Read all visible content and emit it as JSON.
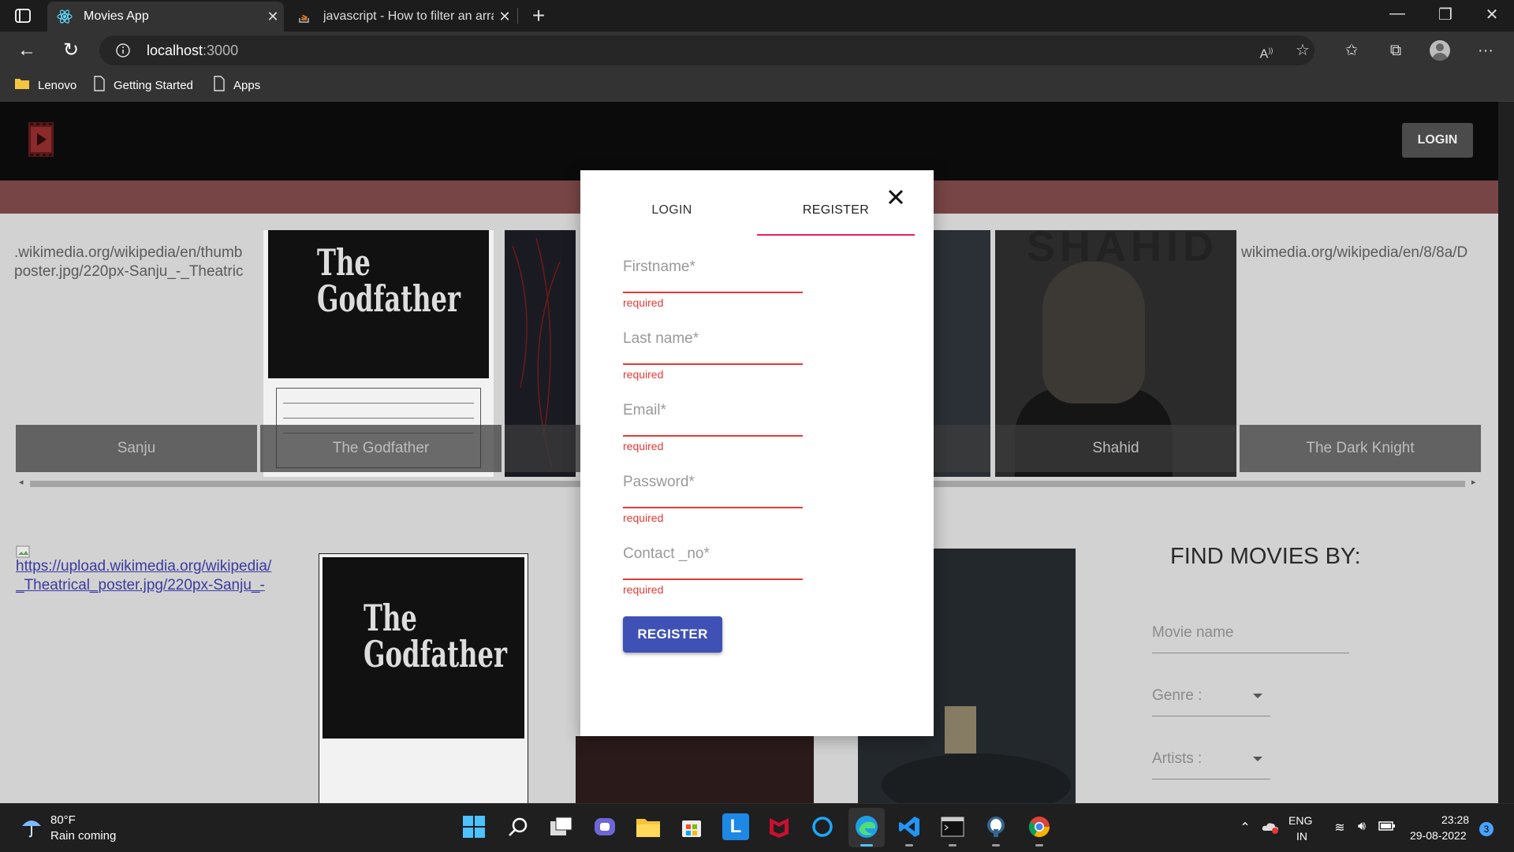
{
  "browser": {
    "tabs": [
      {
        "title": "Movies App",
        "active": true
      },
      {
        "title": "javascript - How to filter an array",
        "active": false
      }
    ],
    "url_host": "localhost",
    "url_port": ":3000",
    "bookmarks": [
      "Lenovo",
      "Getting Started",
      "Apps"
    ]
  },
  "app": {
    "header_login_label": "LOGIN",
    "carousel_url_left": [
      ".wikimedia.org/wikipedia/en/thumb",
      "poster.jpg/220px-Sanju_-_Theatric"
    ],
    "carousel_url_right": "wikimedia.org/wikipedia/en/8/8a/D",
    "captions": [
      "Sanju",
      "The Godfather",
      "Shahid",
      "The Dark Knight"
    ],
    "godfather_poster_text": "The Godfather",
    "shahid_poster_text": "SHAHID",
    "broken_link": [
      "https://upload.wikimedia.org/wikipedia/",
      "_Theatrical_poster.jpg/220px-Sanju_-"
    ],
    "find_title": "FIND MOVIES BY:",
    "find_fields": [
      "Movie name",
      "Genre :",
      "Artists :"
    ]
  },
  "modal": {
    "tab_login": "LOGIN",
    "tab_register": "REGISTER",
    "fields": [
      {
        "placeholder": "Firstname*",
        "error": "required"
      },
      {
        "placeholder": "Last name*",
        "error": "required"
      },
      {
        "placeholder": "Email*",
        "error": "required"
      },
      {
        "placeholder": "Password*",
        "error": "required"
      },
      {
        "placeholder": "Contact _no*",
        "error": "required"
      }
    ],
    "submit_label": "REGISTER"
  },
  "taskbar": {
    "temperature": "80°F",
    "weather": "Rain coming",
    "lang": "ENG",
    "region": "IN",
    "time": "23:28",
    "date": "29-08-2022",
    "notifications": "3"
  },
  "colors": {
    "accent_tab_ink": "#e91e63",
    "error": "#e53935",
    "primary_button": "#3f51b5",
    "header_bar": "#774545"
  }
}
